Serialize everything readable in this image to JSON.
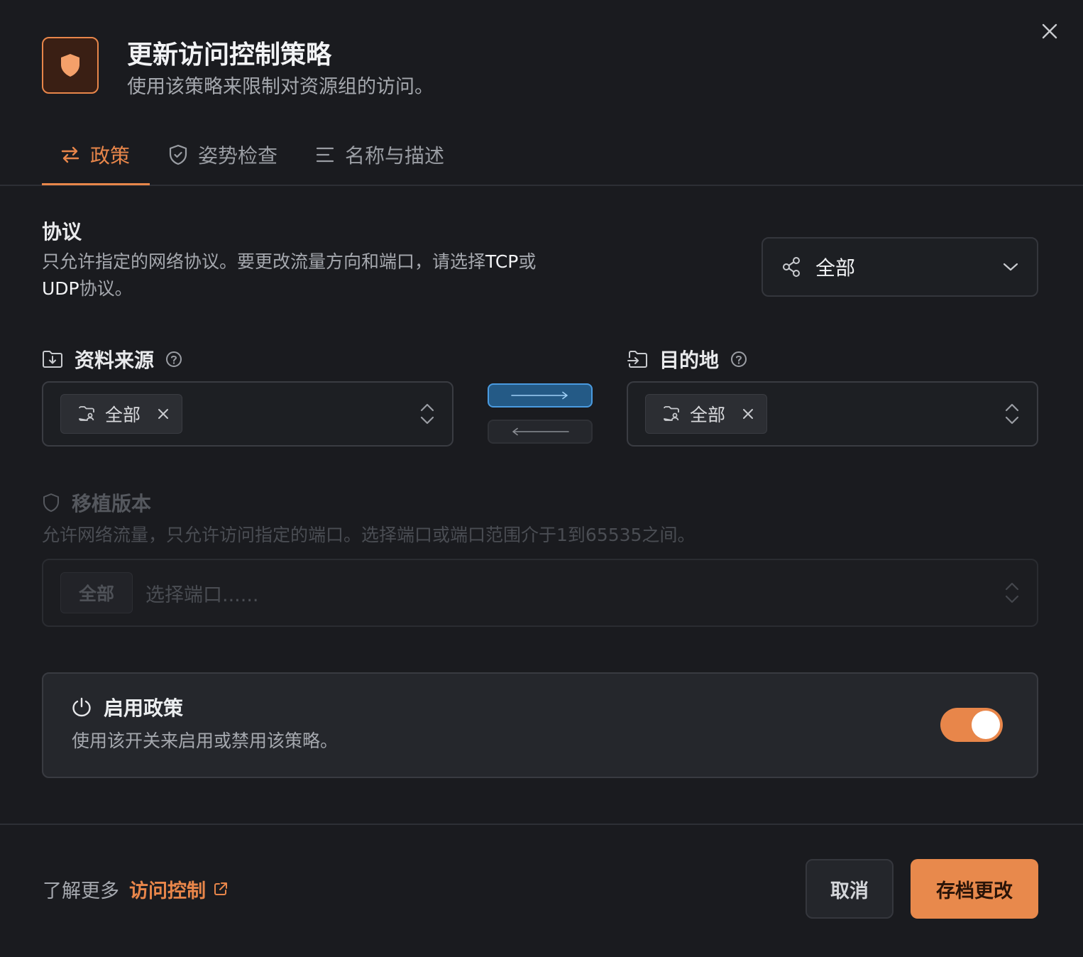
{
  "header": {
    "title": "更新访问控制策略",
    "subtitle": "使用该策略来限制对资源组的访问。"
  },
  "tabs": [
    {
      "label": "政策",
      "icon": "arrows-swap-icon",
      "active": true
    },
    {
      "label": "姿势检查",
      "icon": "shield-check-icon",
      "active": false
    },
    {
      "label": "名称与描述",
      "icon": "text-lines-icon",
      "active": false
    }
  ],
  "protocol": {
    "title": "协议",
    "desc_part1": "只允许指定的网络协议。要更改流量方向和端口，请选择",
    "desc_tcp": "TCP",
    "desc_or": "或",
    "desc_udp": "UDP",
    "desc_part2": "协议。",
    "selected": "全部"
  },
  "source": {
    "label": "资料来源",
    "chip": "全部"
  },
  "destination": {
    "label": "目的地",
    "chip": "全部"
  },
  "direction": {
    "forward_active": true,
    "backward_active": false
  },
  "ports": {
    "title": "移植版本",
    "desc": "允许网络流量，只允许访问指定的端口。选择端口或端口范围介于1到65535之间。",
    "chip": "全部",
    "placeholder": "选择端口......"
  },
  "enable": {
    "title": "启用政策",
    "desc": "使用该开关来启用或禁用该策略。",
    "on": true
  },
  "footer": {
    "learn_prefix": "了解更多",
    "learn_link": "访问控制",
    "cancel": "取消",
    "save": "存档更改"
  },
  "colors": {
    "accent": "#e8864a",
    "direction_active": "#4a9be0",
    "background": "#1a1b1f"
  }
}
